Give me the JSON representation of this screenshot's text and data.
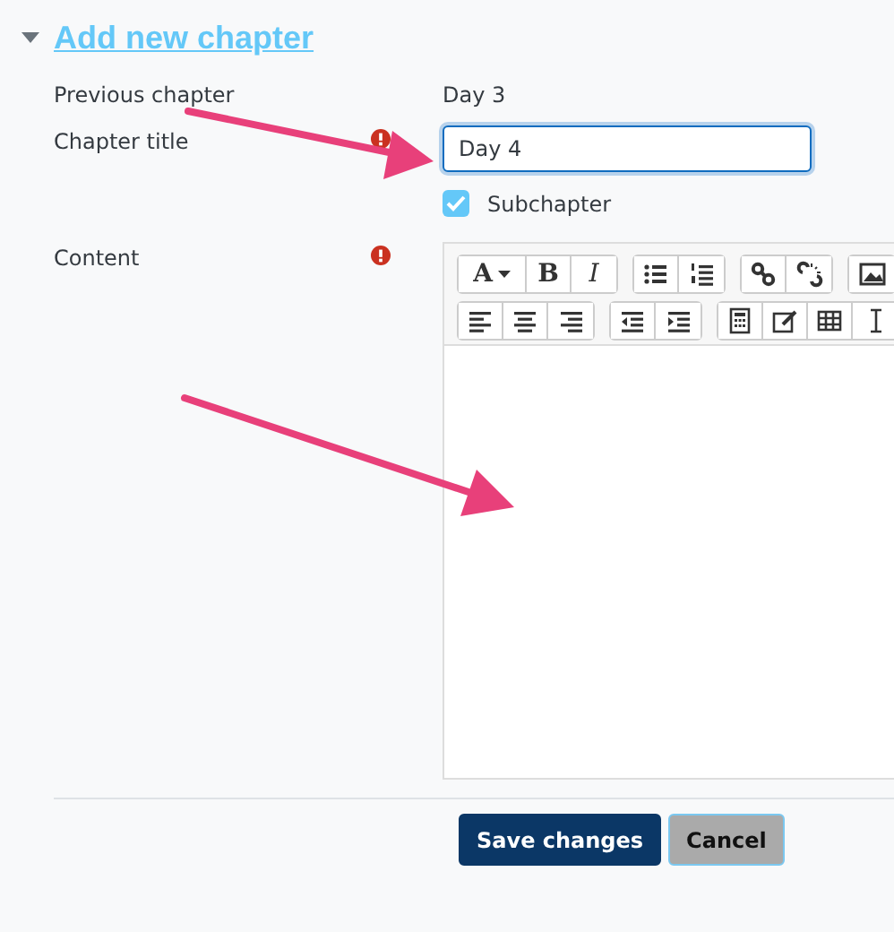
{
  "section": {
    "title": "Add new chapter",
    "expanded": true
  },
  "fields": [
    {
      "kind": "static",
      "label": "Previous chapter",
      "required": false,
      "value": "Day 3"
    },
    {
      "kind": "text",
      "label": "Chapter title",
      "required": true,
      "value": "Day 4"
    },
    {
      "kind": "checkbox",
      "label": "Subchapter",
      "checked": true
    },
    {
      "kind": "editor",
      "label": "Content",
      "required": true,
      "toolbar": [
        [
          [
            {
              "kind": "font-size",
              "text": "A"
            },
            {
              "kind": "bold",
              "text": "B"
            },
            {
              "kind": "italic",
              "text": "I"
            }
          ],
          [
            {
              "kind": "bullet-list"
            },
            {
              "kind": "numbered-list"
            }
          ],
          [
            {
              "kind": "link"
            },
            {
              "kind": "unlink"
            }
          ],
          [
            {
              "kind": "image"
            }
          ]
        ],
        [
          [
            {
              "kind": "align-left"
            },
            {
              "kind": "align-center"
            },
            {
              "kind": "align-right"
            }
          ],
          [
            {
              "kind": "outdent"
            },
            {
              "kind": "indent"
            }
          ],
          [
            {
              "kind": "calculator"
            },
            {
              "kind": "edit"
            },
            {
              "kind": "table"
            },
            {
              "kind": "text-cursor"
            }
          ]
        ]
      ]
    }
  ],
  "buttons": [
    {
      "label": "Save changes",
      "kind": "primary"
    },
    {
      "label": "Cancel",
      "kind": "secondary"
    }
  ]
}
